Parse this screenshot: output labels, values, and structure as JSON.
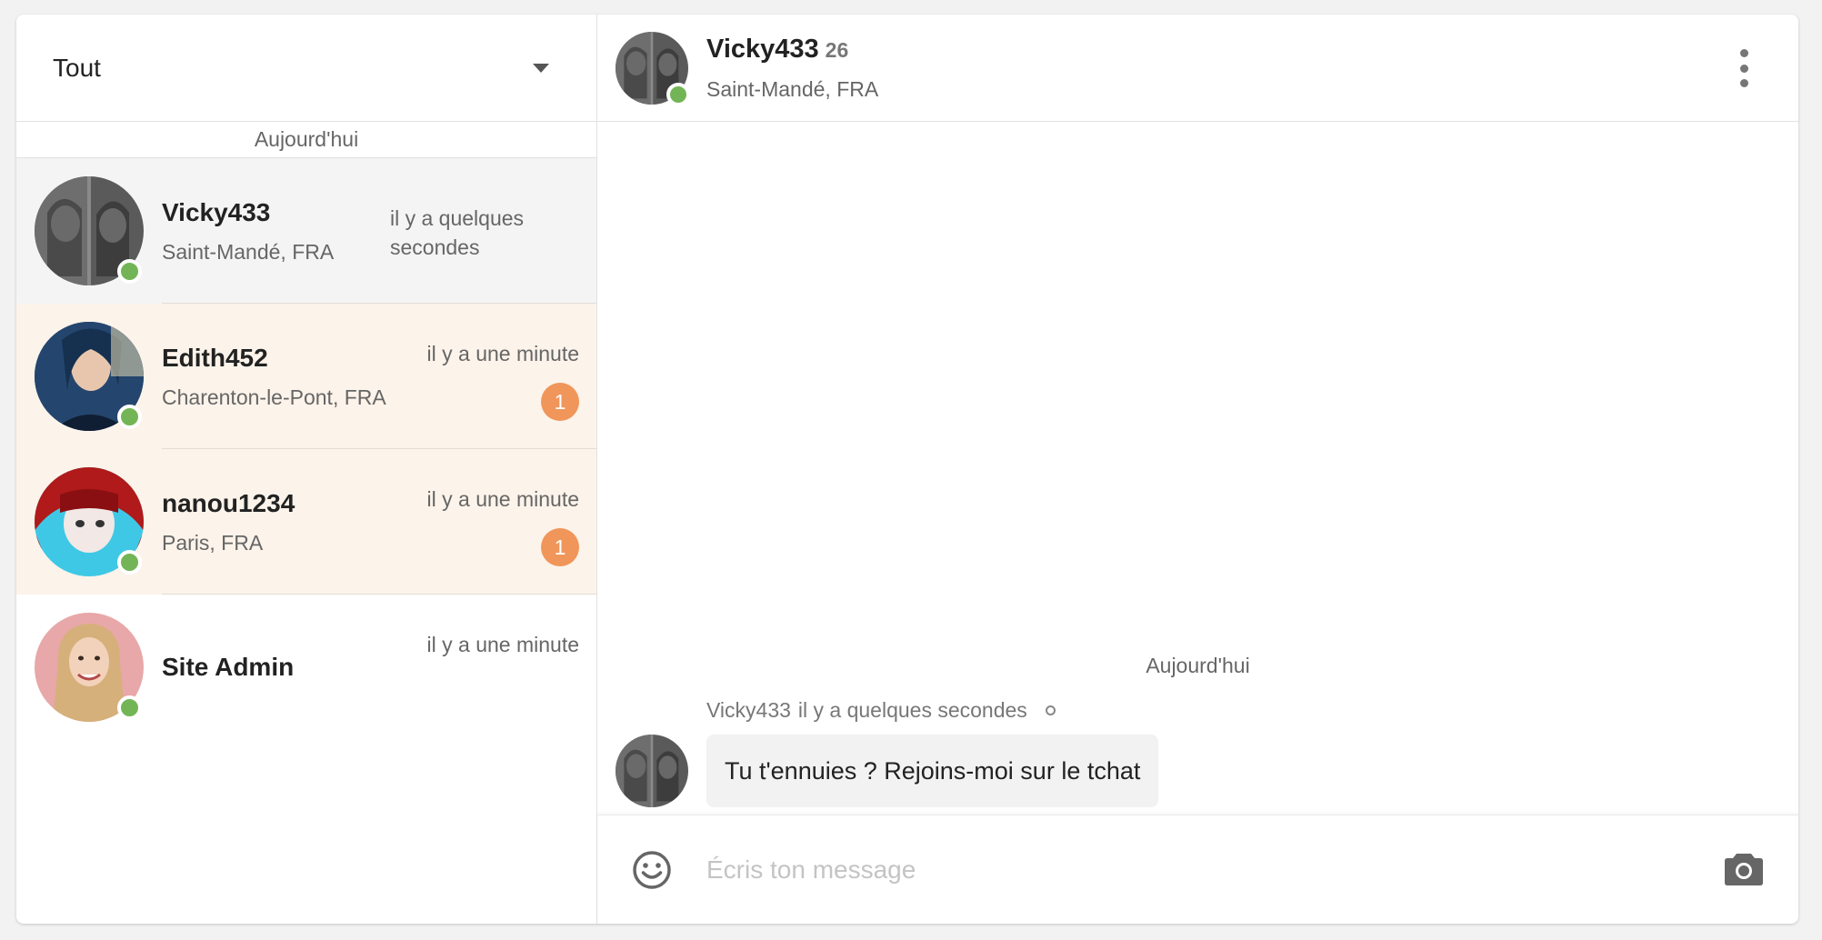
{
  "filter": {
    "label": "Tout"
  },
  "sidebar": {
    "day_label": "Aujourd'hui",
    "conversations": [
      {
        "name": "Vicky433",
        "location": "Saint-Mandé, FRA",
        "time": "il y a quelques secondes",
        "unread": "",
        "state": "active"
      },
      {
        "name": "Edith452",
        "location": "Charenton-le-Pont, FRA",
        "time": "il y a une minute",
        "unread": "1",
        "state": "unread"
      },
      {
        "name": "nanou1234",
        "location": "Paris, FRA",
        "time": "il y a une minute",
        "unread": "1",
        "state": "unread"
      },
      {
        "name": "Site Admin",
        "location": "",
        "time": "il y a une minute",
        "unread": "",
        "state": "read"
      }
    ]
  },
  "chat": {
    "name": "Vicky433",
    "age": "26",
    "location": "Saint-Mandé, FRA",
    "day_label": "Aujourd'hui",
    "messages": [
      {
        "sender": "Vicky433",
        "time": "il y a quelques secondes",
        "text": "Tu t'ennuies ? Rejoins-moi sur le tchat"
      }
    ]
  },
  "composer": {
    "placeholder": "Écris ton message"
  },
  "icons": {
    "filter": "chevron-down-icon",
    "menu": "kebab-menu-icon",
    "emoji": "smiley-icon",
    "photo": "camera-icon"
  },
  "colors": {
    "online": "#73b556",
    "badge": "#f0965a",
    "unread_bg": "#fcf3ea",
    "active_bg": "#f4f4f4"
  }
}
